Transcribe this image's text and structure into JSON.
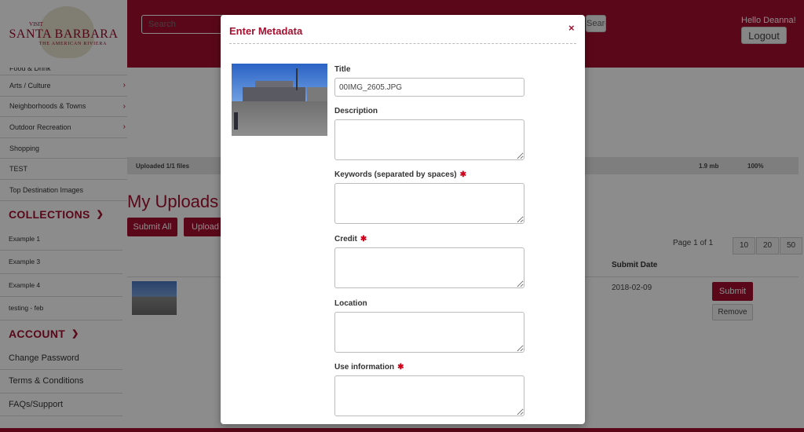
{
  "logo": {
    "line1": "VISIT",
    "line2": "SANTA BARBARA",
    "line3": "THE AMERICAN RIVIERA"
  },
  "header": {
    "search_placeholder": "Search",
    "search_button_label": "Search",
    "greeting": "Hello Deanna!",
    "logout_label": "Logout"
  },
  "sidebar": {
    "partial_item": "Food & Drink",
    "categories": [
      {
        "label": "Arts / Culture"
      },
      {
        "label": "Neighborhoods & Towns"
      },
      {
        "label": "Outdoor Recreation"
      },
      {
        "label": "Shopping"
      },
      {
        "label": "TEST"
      },
      {
        "label": "Top Destination Images"
      }
    ],
    "collections_heading": "COLLECTIONS",
    "collections": [
      "Example 1",
      "Example 3",
      "Example 4",
      "testing - feb"
    ],
    "account_heading": "ACCOUNT",
    "account_items": [
      "Change Password",
      "Terms & Conditions",
      "FAQs/Support"
    ]
  },
  "main": {
    "upload_status": "Uploaded 1/1 files",
    "file_size": "1.9 mb",
    "progress": "100%",
    "uploads_title": "My Uploads",
    "submit_all_label": "Submit All",
    "upload_more_label": "Upload More",
    "pagination": "Page 1 of 1",
    "page_sizes": [
      "10",
      "20",
      "50"
    ],
    "col_submit_date": "Submit Date",
    "row": {
      "date": "2018-02-09",
      "submit_label": "Submit",
      "remove_label": "Remove"
    }
  },
  "modal": {
    "title": "Enter Metadata",
    "close_glyph": "×",
    "fields": {
      "title_label": "Title",
      "title_value": "00IMG_2605.JPG",
      "description_label": "Description",
      "keywords_label": "Keywords (separated by spaces)",
      "credit_label": "Credit",
      "location_label": "Location",
      "use_info_label": "Use information",
      "required_glyph": "✱"
    }
  },
  "colors": {
    "brand": "#a4102f",
    "required": "#d0021b"
  }
}
